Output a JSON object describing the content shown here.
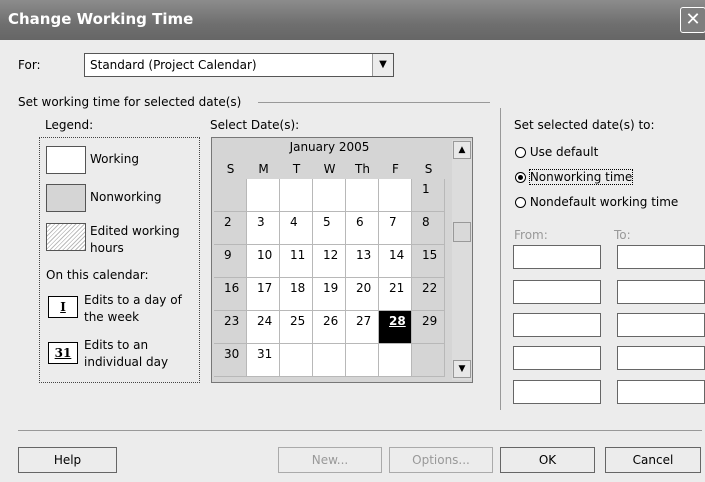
{
  "window": {
    "title": "Change Working Time",
    "close_glyph": "✕"
  },
  "for_label": "For:",
  "calendar_select": {
    "value": "Standard (Project Calendar)"
  },
  "set_working_label": "Set working time for selected date(s)",
  "legend": {
    "label": "Legend:",
    "items": [
      {
        "label": "Working",
        "color": "#ffffff"
      },
      {
        "label": "Nonworking",
        "color": "#d5d5d5"
      },
      {
        "label": "Edited working hours",
        "color": "#e8e8e8"
      }
    ],
    "on_calendar_label": "On this calendar:",
    "edits_weekday": {
      "icon": "I",
      "label": "Edits to a day of the week"
    },
    "edits_day": {
      "icon": "31",
      "label": "Edits to an individual day"
    }
  },
  "select_dates_label": "Select Date(s):",
  "calendar": {
    "month_label": "January 2005",
    "weekdays": [
      "S",
      "M",
      "T",
      "W",
      "Th",
      "F",
      "S"
    ],
    "weeks": [
      [
        "",
        "",
        "",
        "",
        "",
        "",
        "1"
      ],
      [
        "2",
        "3",
        "4",
        "5",
        "6",
        "7",
        "8"
      ],
      [
        "9",
        "10",
        "11",
        "12",
        "13",
        "14",
        "15"
      ],
      [
        "16",
        "17",
        "18",
        "19",
        "20",
        "21",
        "22"
      ],
      [
        "23",
        "24",
        "25",
        "26",
        "27",
        "28",
        "29"
      ],
      [
        "30",
        "31",
        "",
        "",
        "",
        "",
        ""
      ]
    ],
    "selected_day": "28"
  },
  "set_selected_label": "Set selected date(s) to:",
  "options": [
    {
      "label": "Use default",
      "checked": false
    },
    {
      "label": "Nonworking time",
      "checked": true
    },
    {
      "label": "Nondefault working time",
      "checked": false
    }
  ],
  "from_label": "From:",
  "to_label": "To:",
  "buttons": {
    "help": "Help",
    "new": "New...",
    "options": "Options...",
    "ok": "OK",
    "cancel": "Cancel"
  }
}
